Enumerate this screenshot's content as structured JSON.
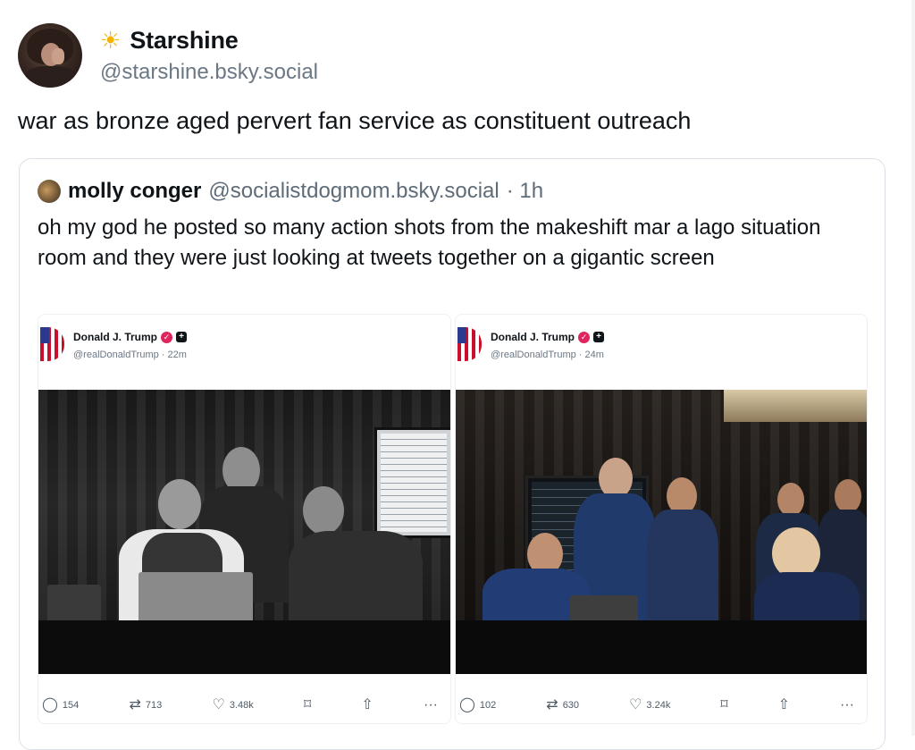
{
  "post": {
    "display_name": "Starshine",
    "name_emoji_icon": "sun-icon",
    "handle": "@starshine.bsky.social",
    "text": "war as bronze aged pervert fan service as constituent outreach"
  },
  "quote": {
    "author_name": "molly conger",
    "author_handle": "@socialistdogmom.bsky.social",
    "time": "· 1h",
    "text": "oh my god he posted so many action shots from the makeshift mar a lago situation room and they were just looking at tweets together on a gigantic screen"
  },
  "embeds": [
    {
      "name": "Donald J. Trump",
      "handle_time": "@realDonaldTrump · 22m",
      "replies": "154",
      "reposts": "713",
      "likes": "3.48k"
    },
    {
      "name": "Donald J. Trump",
      "handle_time": "@realDonaldTrump · 24m",
      "replies": "102",
      "reposts": "630",
      "likes": "3.24k"
    }
  ],
  "icons": {
    "reply": "speech-bubble-icon",
    "repost": "repost-arrows-icon",
    "like": "heart-icon",
    "bookmark": "bookmark-icon",
    "share": "share-icon",
    "more": "more-dots-icon"
  },
  "colors": {
    "text": "#0f1419",
    "muted": "#6b7784",
    "verified": "#e0245e",
    "border": "#dbe1e6"
  }
}
